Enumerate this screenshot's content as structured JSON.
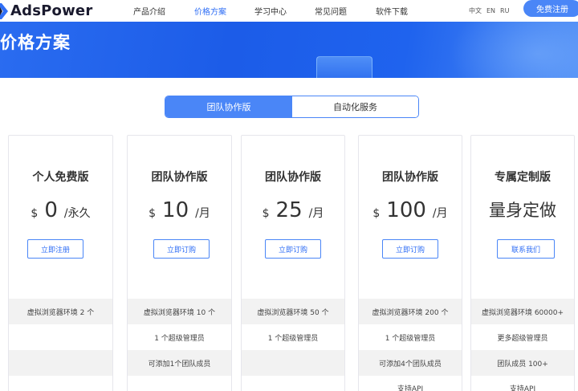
{
  "header": {
    "logo_text": "AdsPower",
    "nav": [
      "产品介绍",
      "价格方案",
      "学习中心",
      "常见问题",
      "软件下载"
    ],
    "active_nav": "价格方案",
    "languages": [
      "中文",
      "EN",
      "RU"
    ],
    "signup_label": "免费注册"
  },
  "banner": {
    "title": "价格方案"
  },
  "tabs": [
    "团队协作版",
    "自动化服务"
  ],
  "active_tab": "团队协作版",
  "plans": [
    {
      "title": "个人免费版",
      "currency": "$",
      "amount": "0",
      "unit": "/永久",
      "button": "立即注册",
      "features": [
        "虚拟浏览器环境 2 个",
        "",
        ""
      ]
    },
    {
      "title": "团队协作版",
      "currency": "$",
      "amount": "10",
      "unit": "/月",
      "button": "立即订购",
      "features": [
        "虚拟浏览器环境 10 个",
        "1 个超级管理员",
        "可添加1个团队成员"
      ]
    },
    {
      "title": "团队协作版",
      "currency": "$",
      "amount": "25",
      "unit": "/月",
      "button": "立即订购",
      "features": [
        "虚拟浏览器环境 50 个",
        "1 个超级管理员",
        ""
      ]
    },
    {
      "title": "团队协作版",
      "currency": "$",
      "amount": "100",
      "unit": "/月",
      "button": "立即订购",
      "features": [
        "虚拟浏览器环境 200 个",
        "1 个超级管理员",
        "可添加4个团队成员",
        "支持API"
      ]
    },
    {
      "title": "专属定制版",
      "custom_price": "量身定做",
      "button": "联系我们",
      "features": [
        "虚拟浏览器环境 60000+",
        "更多超级管理员",
        "团队成员 100+",
        "支持API"
      ]
    }
  ],
  "colors": {
    "accent": "#4a86f7",
    "banner": "#1f63ee",
    "row_gray": "#f2f2f2"
  }
}
